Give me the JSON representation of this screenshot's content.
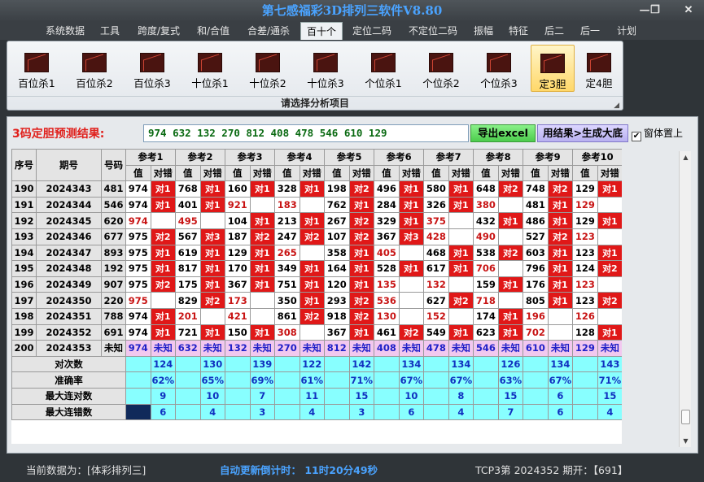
{
  "window": {
    "title": "第七感福彩3D排列三软件V8.80",
    "minimize_glyph": "—",
    "maximize_glyph": "❐",
    "close_glyph": "✕"
  },
  "menu": {
    "items": [
      "系统数据",
      "工具",
      "跨度/复式",
      "和/合值",
      "合差/通杀",
      "百十个",
      "定位二码",
      "不定位二码",
      "振幅",
      "特征",
      "后二",
      "后一",
      "计划"
    ],
    "active": "百十个"
  },
  "ribbon": {
    "buttons": [
      "百位杀1",
      "百位杀2",
      "百位杀3",
      "十位杀1",
      "十位杀2",
      "十位杀3",
      "个位杀1",
      "个位杀2",
      "个位杀3",
      "定3胆",
      "定4胆"
    ],
    "selected": "定3胆",
    "caption": "请选择分析项目"
  },
  "prediction": {
    "label": "3码定胆预测结果:",
    "value": "974 632 132 270 812 408 478 546 610 129",
    "excel_button": "导出excel",
    "generate_button": "用结果>生成大底",
    "topmost_label": "窗体置上",
    "topmost_checked": true
  },
  "table": {
    "col_headers": [
      "序号",
      "期号",
      "号码"
    ],
    "ref_headers": [
      "参考1",
      "参考2",
      "参考3",
      "参考4",
      "参考5",
      "参考6",
      "参考7",
      "参考8",
      "参考9",
      "参考10"
    ],
    "sub_headers": [
      "值",
      "对错"
    ],
    "rows": [
      {
        "seq": "190",
        "issue": "2024343",
        "num": "481",
        "cells": [
          [
            "974",
            "对1"
          ],
          [
            "768",
            "对1"
          ],
          [
            "160",
            "对1"
          ],
          [
            "328",
            "对1"
          ],
          [
            "198",
            "对2"
          ],
          [
            "496",
            "对1"
          ],
          [
            "580",
            "对1"
          ],
          [
            "648",
            "对2"
          ],
          [
            "748",
            "对2"
          ],
          [
            "129",
            "对1"
          ]
        ]
      },
      {
        "seq": "191",
        "issue": "2024344",
        "num": "546",
        "cells": [
          [
            "974",
            "对1"
          ],
          [
            "401",
            "对1"
          ],
          [
            "921",
            ""
          ],
          [
            "183",
            ""
          ],
          [
            "762",
            "对1"
          ],
          [
            "284",
            "对1"
          ],
          [
            "326",
            "对1"
          ],
          [
            "380",
            ""
          ],
          [
            "481",
            "对1"
          ],
          [
            "129",
            ""
          ]
        ]
      },
      {
        "seq": "192",
        "issue": "2024345",
        "num": "620",
        "cells": [
          [
            "974",
            ""
          ],
          [
            "495",
            ""
          ],
          [
            "104",
            "对1"
          ],
          [
            "213",
            "对1"
          ],
          [
            "267",
            "对2"
          ],
          [
            "329",
            "对1"
          ],
          [
            "375",
            ""
          ],
          [
            "432",
            "对1"
          ],
          [
            "486",
            "对1"
          ],
          [
            "129",
            "对1"
          ]
        ]
      },
      {
        "seq": "193",
        "issue": "2024346",
        "num": "677",
        "cells": [
          [
            "975",
            "对2"
          ],
          [
            "567",
            "对3"
          ],
          [
            "187",
            "对2"
          ],
          [
            "247",
            "对2"
          ],
          [
            "107",
            "对2"
          ],
          [
            "367",
            "对3"
          ],
          [
            "428",
            ""
          ],
          [
            "490",
            ""
          ],
          [
            "527",
            "对2"
          ],
          [
            "123",
            ""
          ]
        ]
      },
      {
        "seq": "194",
        "issue": "2024347",
        "num": "893",
        "cells": [
          [
            "975",
            "对1"
          ],
          [
            "619",
            "对1"
          ],
          [
            "129",
            "对1"
          ],
          [
            "265",
            ""
          ],
          [
            "358",
            "对1"
          ],
          [
            "405",
            ""
          ],
          [
            "468",
            "对1"
          ],
          [
            "538",
            "对2"
          ],
          [
            "603",
            "对1"
          ],
          [
            "123",
            "对1"
          ]
        ]
      },
      {
        "seq": "195",
        "issue": "2024348",
        "num": "192",
        "cells": [
          [
            "975",
            "对1"
          ],
          [
            "817",
            "对1"
          ],
          [
            "170",
            "对1"
          ],
          [
            "349",
            "对1"
          ],
          [
            "164",
            "对1"
          ],
          [
            "528",
            "对1"
          ],
          [
            "617",
            "对1"
          ],
          [
            "706",
            ""
          ],
          [
            "796",
            "对1"
          ],
          [
            "124",
            "对2"
          ]
        ]
      },
      {
        "seq": "196",
        "issue": "2024349",
        "num": "907",
        "cells": [
          [
            "975",
            "对2"
          ],
          [
            "175",
            "对1"
          ],
          [
            "367",
            "对1"
          ],
          [
            "751",
            "对1"
          ],
          [
            "120",
            "对1"
          ],
          [
            "135",
            ""
          ],
          [
            "132",
            ""
          ],
          [
            "159",
            "对1"
          ],
          [
            "176",
            "对1"
          ],
          [
            "123",
            ""
          ]
        ]
      },
      {
        "seq": "197",
        "issue": "2024350",
        "num": "220",
        "cells": [
          [
            "975",
            ""
          ],
          [
            "829",
            "对2"
          ],
          [
            "173",
            ""
          ],
          [
            "350",
            "对1"
          ],
          [
            "293",
            "对2"
          ],
          [
            "536",
            ""
          ],
          [
            "627",
            "对2"
          ],
          [
            "718",
            ""
          ],
          [
            "805",
            "对1"
          ],
          [
            "123",
            "对2"
          ]
        ]
      },
      {
        "seq": "198",
        "issue": "2024351",
        "num": "788",
        "cells": [
          [
            "974",
            "对1"
          ],
          [
            "201",
            ""
          ],
          [
            "421",
            ""
          ],
          [
            "861",
            "对2"
          ],
          [
            "918",
            "对2"
          ],
          [
            "130",
            ""
          ],
          [
            "152",
            ""
          ],
          [
            "174",
            "对1"
          ],
          [
            "196",
            ""
          ],
          [
            "126",
            ""
          ]
        ]
      },
      {
        "seq": "199",
        "issue": "2024352",
        "num": "691",
        "cells": [
          [
            "974",
            "对1"
          ],
          [
            "721",
            "对1"
          ],
          [
            "150",
            "对1"
          ],
          [
            "308",
            ""
          ],
          [
            "367",
            "对1"
          ],
          [
            "461",
            "对2"
          ],
          [
            "549",
            "对1"
          ],
          [
            "623",
            "对1"
          ],
          [
            "702",
            ""
          ],
          [
            "128",
            "对1"
          ]
        ]
      }
    ],
    "pending": {
      "seq": "200",
      "issue": "2024353",
      "num": "未知",
      "values": [
        "974",
        "632",
        "132",
        "270",
        "812",
        "408",
        "478",
        "546",
        "610",
        "129"
      ],
      "status": "未知"
    },
    "stats": [
      {
        "label": "对次数",
        "values": [
          "124",
          "130",
          "139",
          "122",
          "142",
          "134",
          "134",
          "126",
          "134",
          "143"
        ]
      },
      {
        "label": "准确率",
        "values": [
          "62%",
          "65%",
          "69%",
          "61%",
          "71%",
          "67%",
          "67%",
          "63%",
          "67%",
          "71%"
        ]
      },
      {
        "label": "最大连对数",
        "values": [
          "9",
          "10",
          "7",
          "11",
          "15",
          "10",
          "8",
          "15",
          "6",
          "15"
        ]
      },
      {
        "label": "最大连错数",
        "values": [
          "6",
          "4",
          "3",
          "4",
          "3",
          "6",
          "4",
          "7",
          "6",
          "4"
        ]
      }
    ]
  },
  "status": {
    "current_data": "当前数据为：[体彩排列三]",
    "countdown": "自动更新倒计时： 11时20分49秒",
    "latest": "TCP3第 2024352 期开：【691】"
  },
  "colors": {
    "hit_red": "#e01818",
    "unknown_pink": "#f2c8ef",
    "stats_cyan": "#88ffff",
    "accent_blue": "#4aa3ff"
  }
}
